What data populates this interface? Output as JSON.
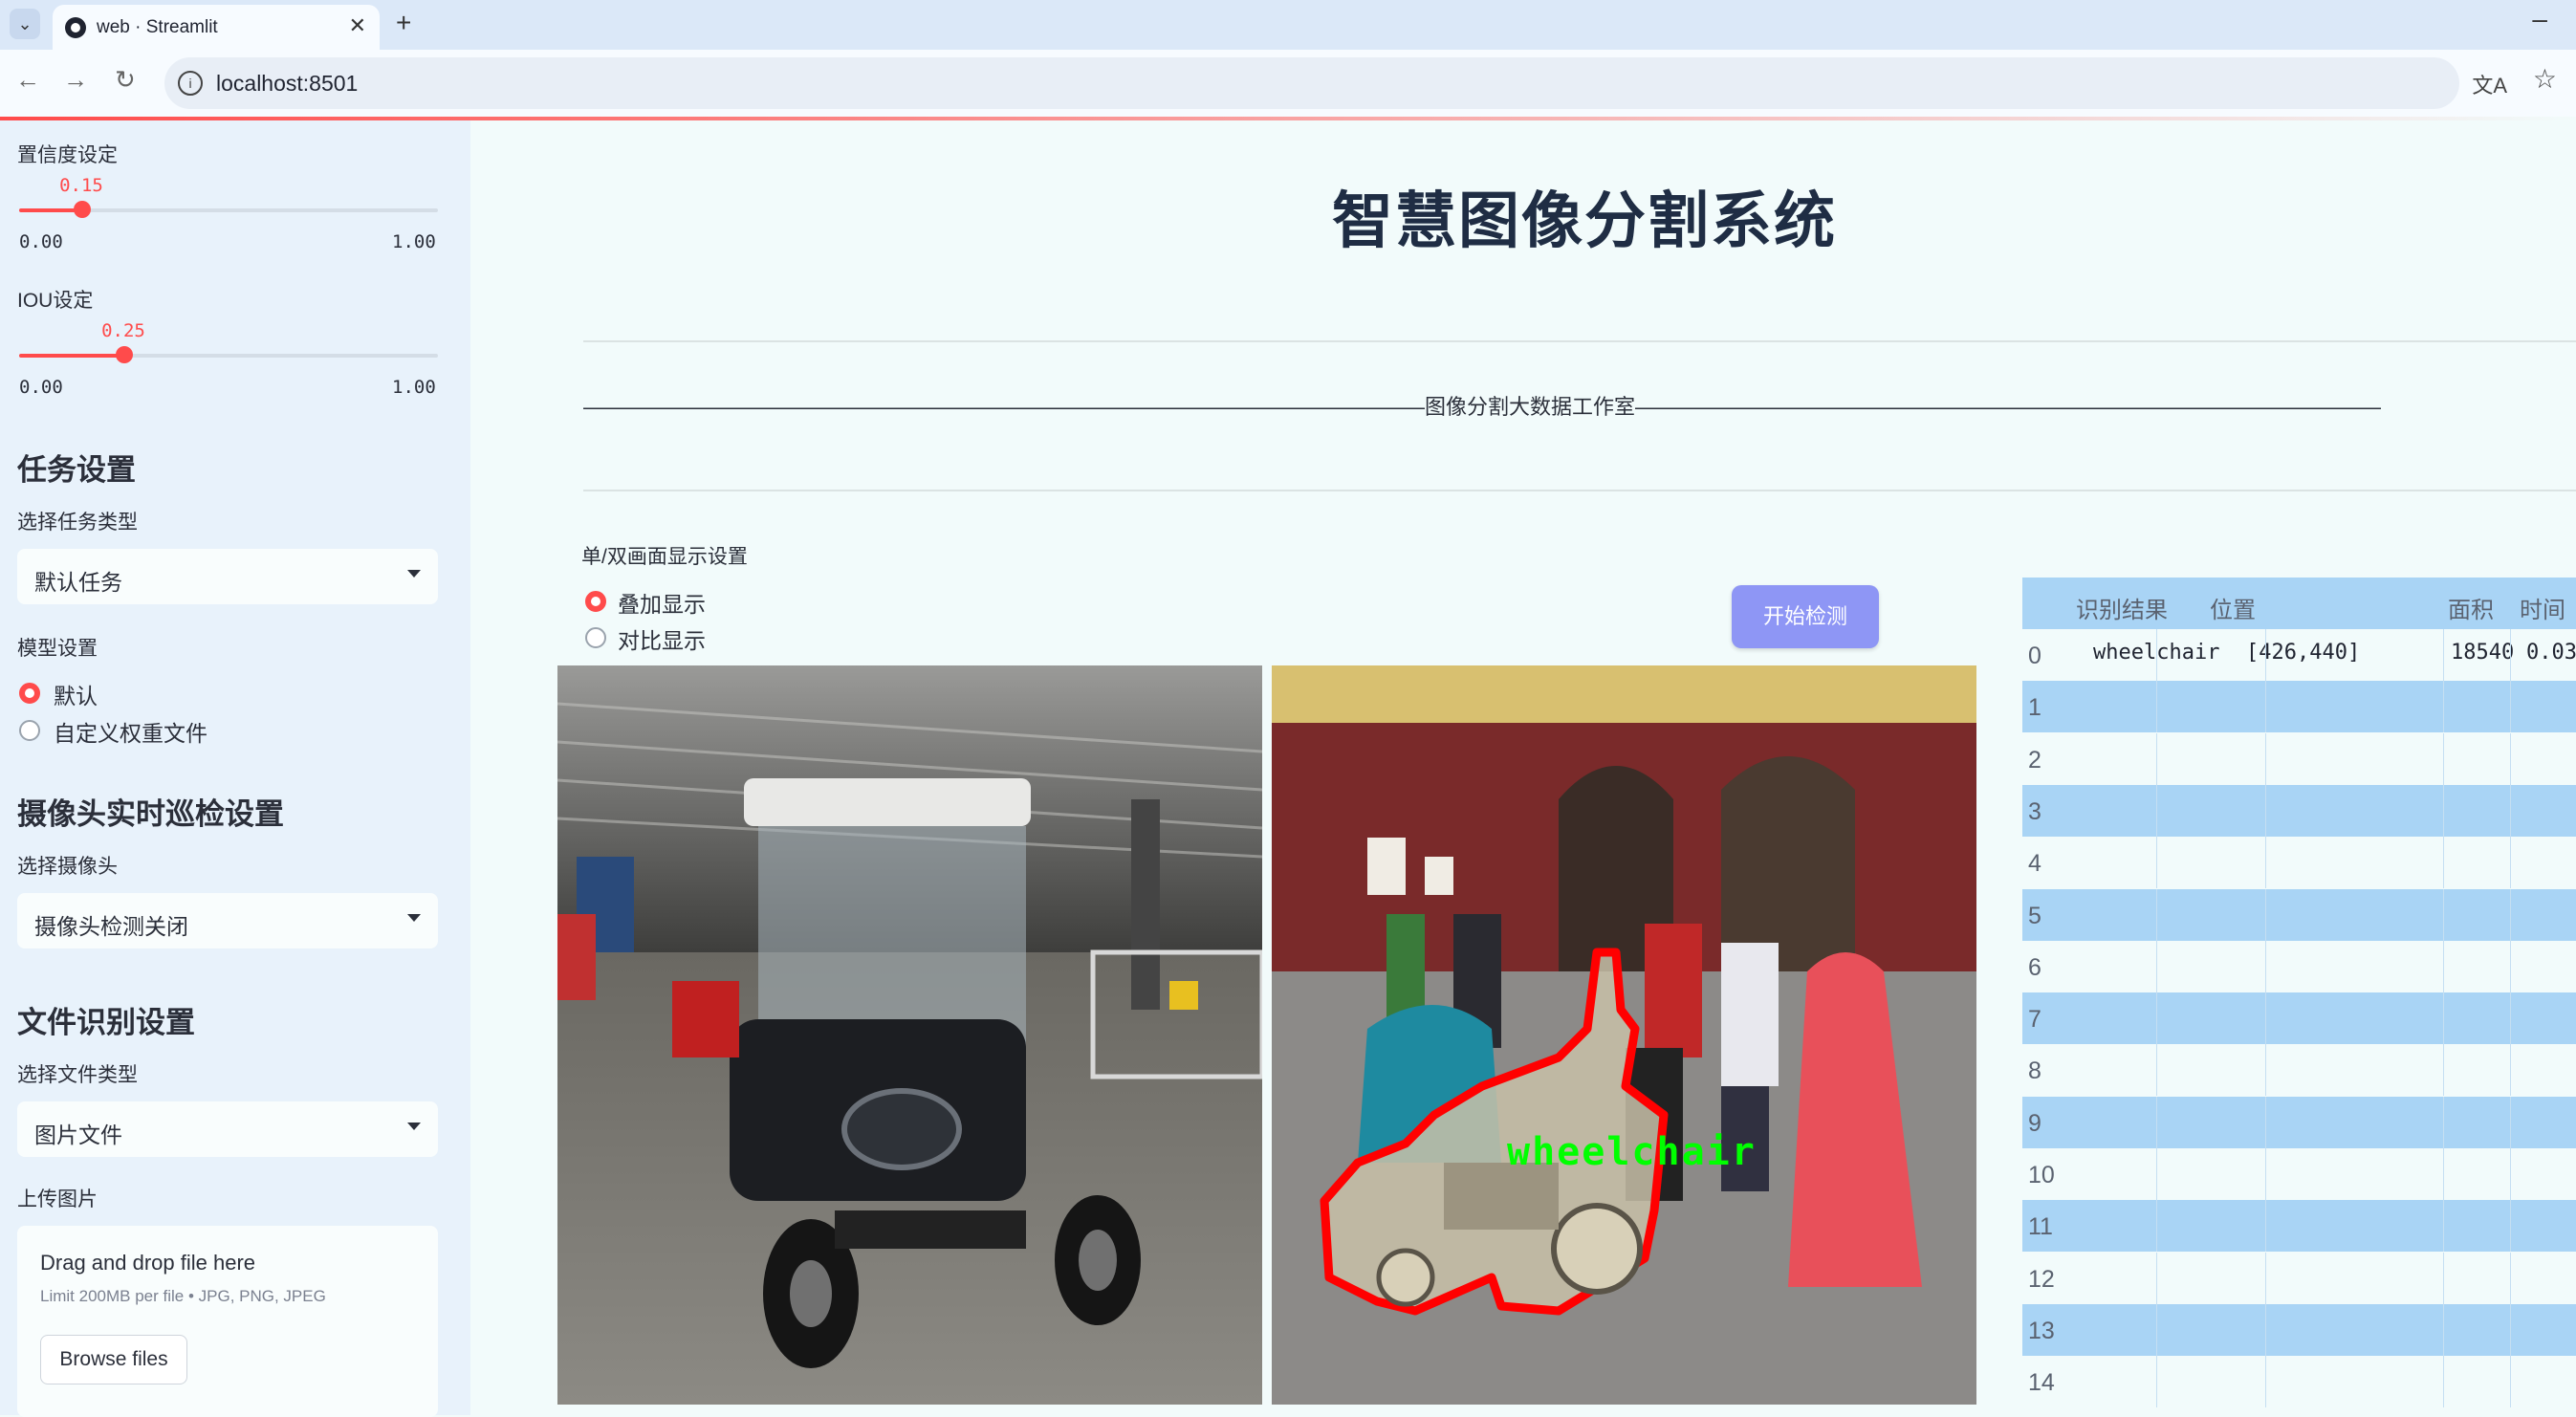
{
  "browser": {
    "tab_title": "web · Streamlit",
    "url": "localhost:8501"
  },
  "sidebar": {
    "confidence": {
      "label": "置信度设定",
      "value": "0.15",
      "value_fraction": 0.15,
      "min": "0.00",
      "max": "1.00"
    },
    "iou": {
      "label": "IOU设定",
      "value": "0.25",
      "value_fraction": 0.25,
      "min": "0.00",
      "max": "1.00"
    },
    "task": {
      "heading": "任务设置",
      "label": "选择任务类型",
      "selected": "默认任务"
    },
    "model": {
      "label": "模型设置",
      "options": [
        "默认",
        "自定义权重文件"
      ],
      "selected_index": 0
    },
    "camera": {
      "heading": "摄像头实时巡检设置",
      "label": "选择摄像头",
      "selected": "摄像头检测关闭"
    },
    "file": {
      "heading": "文件识别设置",
      "label": "选择文件类型",
      "selected": "图片文件"
    },
    "upload": {
      "label": "上传图片",
      "drop_text": "Drag and drop file here",
      "limit_text": "Limit 200MB per file • JPG, PNG, JPEG",
      "browse_button": "Browse files"
    }
  },
  "main": {
    "title": "智慧图像分割系统",
    "divider_text": "————————————————————————————————————————图像分割大数据工作室————————————————————————————————————————",
    "display_label": "单/双画面显示设置",
    "display_options": [
      "叠加显示",
      "对比显示"
    ],
    "display_selected_index": 0,
    "start_button": "开始检测",
    "overlay_label": "wheelchair"
  },
  "table": {
    "headers": [
      "识别结果",
      "位置",
      "面积",
      "时间"
    ],
    "rows": [
      {
        "index": "0",
        "result": "wheelchair",
        "position": "[426,440]",
        "area": "18540",
        "time": "0.03"
      },
      {
        "index": "1"
      },
      {
        "index": "2"
      },
      {
        "index": "3"
      },
      {
        "index": "4"
      },
      {
        "index": "5"
      },
      {
        "index": "6"
      },
      {
        "index": "7"
      },
      {
        "index": "8"
      },
      {
        "index": "9"
      },
      {
        "index": "10"
      },
      {
        "index": "11"
      },
      {
        "index": "12"
      },
      {
        "index": "13"
      },
      {
        "index": "14"
      }
    ]
  },
  "colors": {
    "accent": "#ff4b4b",
    "button": "#8e96f5",
    "table_stripe": "#a9d4f5",
    "sidebar_bg": "#e8f2fb",
    "mask_outline": "#ff0000",
    "label_text": "#00ff00"
  }
}
